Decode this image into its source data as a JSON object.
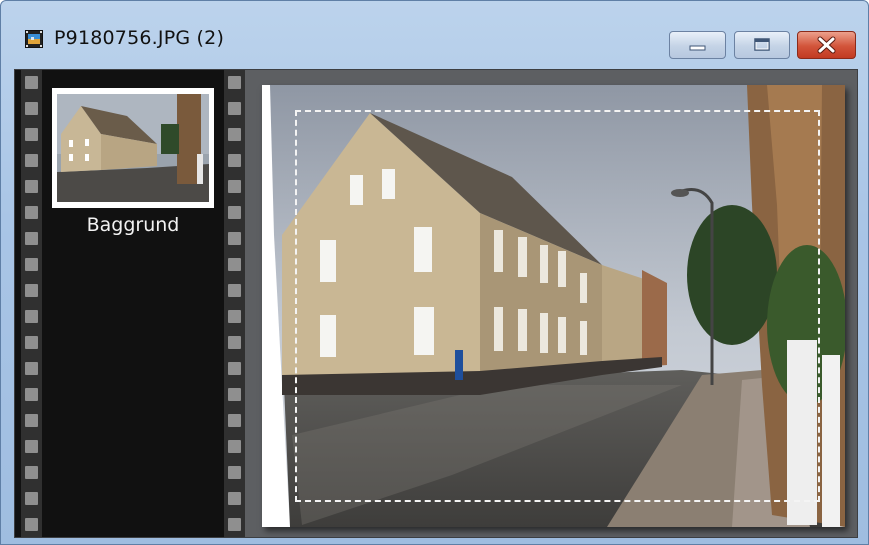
{
  "window": {
    "title": "P9180756.JPG (2)",
    "icon": "film-image-icon",
    "controls": {
      "minimize": "minimize-icon",
      "maximize": "maximize-icon",
      "close": "close-icon"
    }
  },
  "layers": [
    {
      "label": "Baggrund"
    }
  ],
  "colors": {
    "titlebar": "#a9c5e6",
    "filmstrip_bg": "#111111",
    "perforation": "#8f8f8f",
    "canvas_bg": "#5d5f62",
    "close_button": "#c9432b"
  }
}
